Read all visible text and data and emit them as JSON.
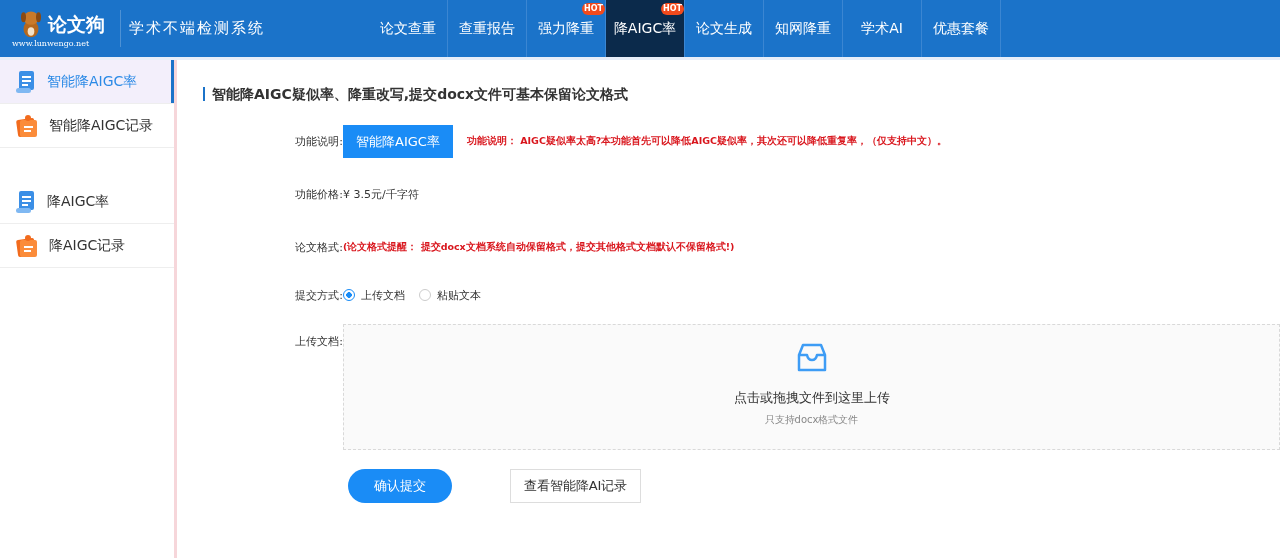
{
  "header": {
    "logo_title": "论文狗",
    "logo_url": "www.lunwengo.net",
    "slogan": "学术不端检测系统",
    "nav": [
      {
        "label": "论文查重",
        "selected": false,
        "hot": false
      },
      {
        "label": "查重报告",
        "selected": false,
        "hot": false
      },
      {
        "label": "强力降重",
        "selected": false,
        "hot": true,
        "badge": "HOT"
      },
      {
        "label": "降AIGC率",
        "selected": true,
        "hot": true,
        "badge": "HOT"
      },
      {
        "label": "论文生成",
        "selected": false,
        "hot": false
      },
      {
        "label": "知网降重",
        "selected": false,
        "hot": false
      },
      {
        "label": "学术AI",
        "selected": false,
        "hot": false
      },
      {
        "label": "优惠套餐",
        "selected": false,
        "hot": false
      }
    ]
  },
  "sidebar": {
    "groups": [
      [
        {
          "label": "智能降AIGC率",
          "kind": "doc",
          "selected": true
        },
        {
          "label": "智能降AIGC记录",
          "kind": "record",
          "selected": false
        }
      ],
      [
        {
          "label": "降AIGC率",
          "kind": "doc",
          "selected": false
        },
        {
          "label": "降AIGC记录",
          "kind": "record",
          "selected": false
        }
      ]
    ]
  },
  "main": {
    "title": "智能降AIGC疑似率、降重改写,提交docx文件可基本保留论文格式",
    "rows": [
      {
        "kind": "feature",
        "label": "功能说明:",
        "button": "智能降AIGC率",
        "note": "功能说明： AIGC疑似率太高?本功能首先可以降低AIGC疑似率，其次还可以降低重复率，（仅支持中文）。"
      },
      {
        "kind": "text",
        "label": "功能价格:",
        "value": "¥ 3.5元/千字符"
      },
      {
        "kind": "warning",
        "label": "论文格式:",
        "value": "(论文格式提醒： 提交docx文档系统自动保留格式，提交其他格式文档默认不保留格式!)"
      },
      {
        "kind": "radio",
        "label": "提交方式:",
        "options": [
          {
            "label": "上传文档",
            "selected": true
          },
          {
            "label": "粘贴文本",
            "selected": false
          }
        ]
      },
      {
        "kind": "upload",
        "label": "上传文档:",
        "text": "点击或拖拽文件到这里上传",
        "hint": "只支持docx格式文件"
      }
    ],
    "buttons": [
      {
        "label": "确认提交",
        "kind": "primary"
      },
      {
        "label": "查看智能降AI记录",
        "kind": "default"
      }
    ]
  }
}
